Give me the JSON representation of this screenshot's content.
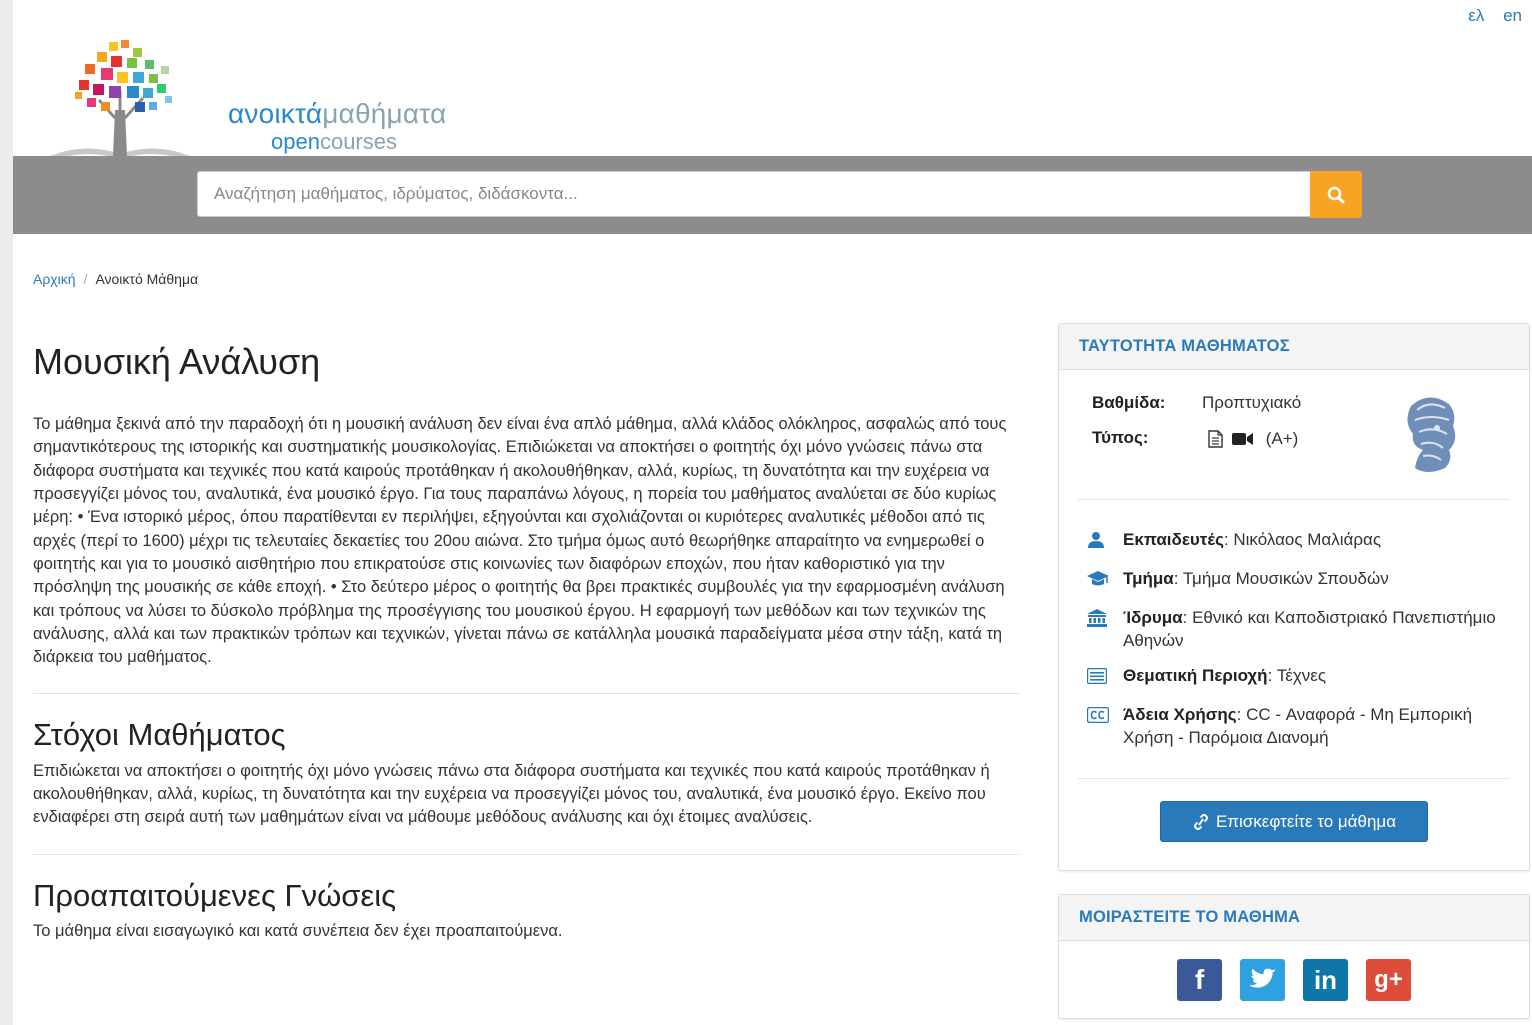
{
  "lang": {
    "el": "ελ",
    "en": "en"
  },
  "logo": {
    "part1": "ανοικτά",
    "part2": "μαθήματα",
    "part3": "open",
    "part4": "courses"
  },
  "search": {
    "placeholder": "Αναζήτηση μαθήματος, ιδρύματος, διδάσκοντα..."
  },
  "breadcrumb": {
    "home": "Αρχική",
    "separator": "/",
    "current": "Ανοικτό Μάθημα"
  },
  "course": {
    "title": "Μουσική Ανάλυση",
    "description": "Το μάθημα ξεκινά από την παραδοχή ότι η μουσική ανάλυση δεν είναι ένα απλό μάθημα, αλλά κλάδος ολόκληρος, ασφαλώς από τους σημαντικότερους της ιστορικής και συστηματικής μουσικολογίας. Επιδιώκεται να αποκτήσει ο φοιτητής όχι μόνο γνώσεις πάνω στα διάφορα συστήματα και τεχνικές που κατά καιρούς προτάθηκαν ή ακολουθήθηκαν, αλλά, κυρίως, τη δυνατότητα και την ευχέρεια να προσεγγίζει μόνος του, αναλυτικά, ένα μουσικό έργο. Για τους παραπάνω λόγους, η πορεία του μαθήματος αναλύεται σε δύο κυρίως μέρη: • Ένα ιστορικό μέρος, όπου παρατίθενται εν περιλήψει, εξηγούνται και σχολιάζονται οι κυριότερες αναλυτικές μέθοδοι από τις αρχές (περί το 1600) μέχρι τις τελευταίες δεκαετίες του 20ου αιώνα. Στο τμήμα όμως αυτό θεωρήθηκε απαραίτητο να ενημερωθεί ο φοιτητής και για το μουσικό αισθητήριο που επικρατούσε στις κοινωνίες των διαφόρων εποχών, που ήταν καθοριστικό για την πρόσληψη της μουσικής σε κάθε εποχή. • Στο δεύτερο μέρος ο φοιτητής θα βρει πρακτικές συμβουλές για την εφαρμοσμένη ανάλυση και τρόπους να λύσει το δύσκολο πρόβλημα της προσέγγισης του μουσικού έργου. Η εφαρμογή των μεθόδων και των τεχνικών της ανάλυσης, αλλά και των πρακτικών τρόπων και τεχνικών, γίνεται πάνω σε κατάλληλα μουσικά παραδείγματα μέσα στην τάξη, κατά τη διάρκεια του μαθήματος.",
    "goals_title": "Στόχοι Μαθήματος",
    "goals_text": "Επιδιώκεται να αποκτήσει ο φοιτητής όχι μόνο γνώσεις πάνω στα διάφορα συστήματα και τεχνικές που κατά καιρούς προτάθηκαν ή ακολουθήθηκαν, αλλά, κυρίως, τη δυνατότητα και την ευχέρεια να προσεγγίζει μόνος του, αναλυτικά, ένα μουσικό έργο. Εκείνο που ενδιαφέρει στη σειρά αυτή των μαθημάτων είναι να μάθουμε μεθόδους ανάλυσης και όχι έτοιμες αναλύσεις.",
    "prereq_title": "Προαπαιτούμενες Γνώσεις",
    "prereq_text": "Το μάθημα είναι εισαγωγικό και κατά συνέπεια δεν έχει προαπαιτούμενα."
  },
  "identity": {
    "header": "ΤΑΥΤΟΤΗΤΑ ΜΑΘΗΜΑΤΟΣ",
    "level_label": "Βαθμίδα:",
    "level_value": "Προπτυχιακό",
    "type_label": "Τύπος:",
    "type_value": "(A+)",
    "instructor_label": "Εκπαιδευτές",
    "instructor_value": ": Νικόλαος Μαλιάρας",
    "department_label": "Τμήμα",
    "department_value": ": Τμήμα Μουσικών Σπουδών",
    "institution_label": "Ίδρυμα",
    "institution_value": ": Εθνικό και Καποδιστριακό Πανεπιστήμιο Αθηνών",
    "area_label": "Θεματική Περιοχή",
    "area_value": ": Τέχνες",
    "license_label": "Άδεια Χρήσης",
    "license_value": ": CC - Αναφορά - Μη Εμπορική Χρήση - Παρόμοια Διανομή",
    "visit_button": "Επισκεφτείτε το μάθημα"
  },
  "share": {
    "header": "ΜΟΙΡΑΣΤΕΙΤΕ ΤΟ ΜΑΘΗΜΑ",
    "facebook": "f",
    "linkedin": "in",
    "googleplus": "g+"
  },
  "colors": {
    "accent": "#2a7ab9",
    "search_button": "#f7a323",
    "band": "#8c8c8c",
    "facebook": "#3b5998",
    "twitter": "#2ea1e0",
    "linkedin": "#0e76a8",
    "googleplus": "#dd4b39"
  },
  "icons": {
    "search": "search-icon",
    "document": "document-icon",
    "video": "video-camera-icon",
    "instructor": "user-icon",
    "department": "graduation-cap-icon",
    "institution": "institution-icon",
    "area": "list-icon",
    "license": "cc-icon",
    "link": "link-icon",
    "university_logo": "athena-logo"
  }
}
